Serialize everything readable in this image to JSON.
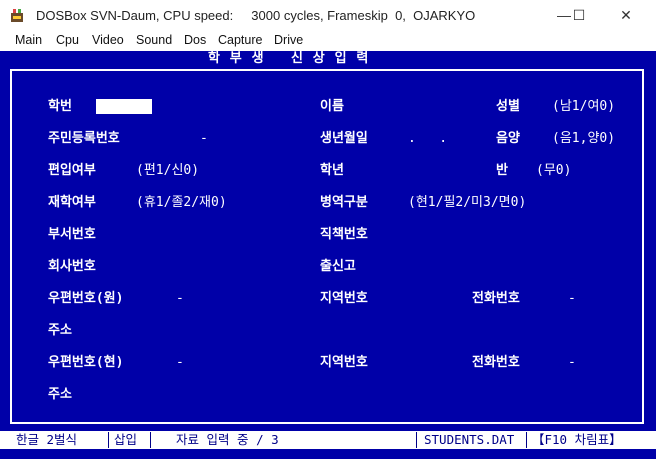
{
  "window": {
    "title": "DOSBox SVN-Daum, CPU speed:     3000 cycles, Frameskip  0,  OJARKYO",
    "minimize": "—",
    "maximize": "☐",
    "close": "✕"
  },
  "menu": [
    "Main",
    "Cpu",
    "Video",
    "Sound",
    "Dos",
    "Capture",
    "Drive"
  ],
  "screen_title": "학 부 생   신 상 입 력",
  "form": {
    "hakbeon": "학번",
    "ireum": "이름",
    "seongbyeol": "성별",
    "seongbyeol_hint": "(남1/여0)",
    "jumin": "주민등록번호",
    "jumin_sep": "-",
    "saengnyeon": "생년월일",
    "saengnyeon_sep": ".   .",
    "eumyang": "음양",
    "eumyang_hint": "(음1,양0)",
    "pyeonip": "편입여부",
    "pyeonip_hint": "(편1/신0)",
    "haknyeon": "학년",
    "ban": "반",
    "ban_hint": "(무0)",
    "jaehak": "재학여부",
    "jaehak_hint": "(휴1/졸2/재0)",
    "byeongyeok": "병역구분",
    "byeongyeok_hint": "(현1/필2/미3/면0)",
    "buseo": "부서번호",
    "jikchaek": "직책번호",
    "hoesa": "회사번호",
    "chulsin": "출신고",
    "zip_won": "우편번호(원)",
    "zip_won_sep": "-",
    "area_1": "지역번호",
    "phone_1": "전화번호",
    "phone_1_sep": "-",
    "addr_1": "주소",
    "zip_hyeon": "우편번호(현)",
    "zip_hyeon_sep": "-",
    "area_2": "지역번호",
    "phone_2": "전화번호",
    "phone_2_sep": "-",
    "addr_2": "주소"
  },
  "statusbar": {
    "ime": "한글 2벌식",
    "mode": "삽입",
    "message": "자료 입력 중 / 3",
    "file": "STUDENTS.DAT",
    "help": "【F10 차림표】"
  },
  "colors": {
    "background": "#0000a8",
    "text": "#ffffff",
    "statusbar_text": "#000088"
  }
}
